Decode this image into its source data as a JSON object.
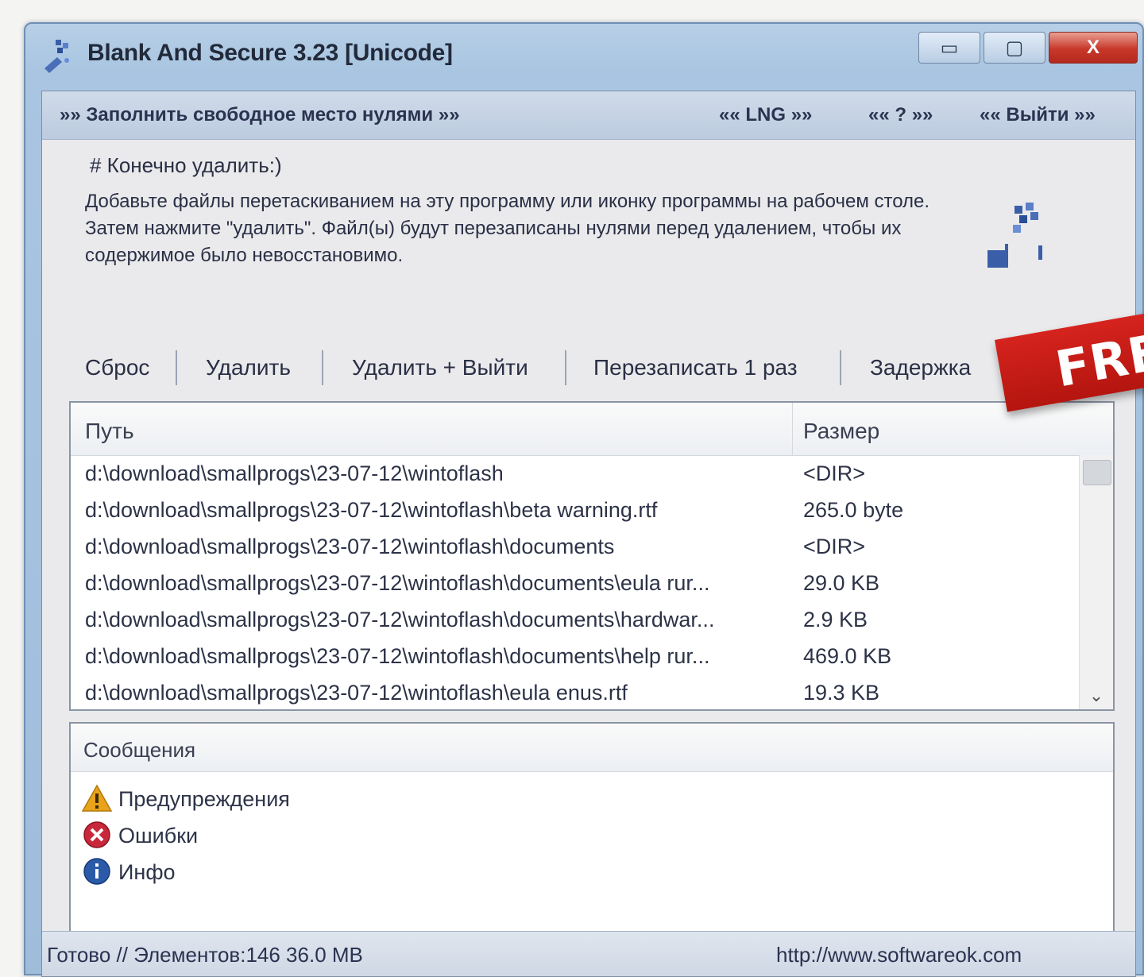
{
  "window": {
    "title": "Blank And Secure 3.23 [Unicode]",
    "controls": {
      "minimize": "▭",
      "maximize": "▢",
      "close": "X"
    }
  },
  "menu": {
    "fill_free_space": "»» Заполнить свободное место нулями »»",
    "language": "«« LNG »»",
    "help": "«« ? »»",
    "exit": "«« Выйти »»"
  },
  "options": {
    "confirm_delete": "# Конечно удалить:)"
  },
  "description": "Добавьте файлы перетаскиванием на эту программу или иконку программы на рабочем столе. Затем нажмите \"удалить\". Файл(ы) будут перезаписаны нулями перед удалением, чтобы их содержимое было невосстановимо.",
  "actions": {
    "reset": "Сброс",
    "delete": "Удалить",
    "delete_exit": "Удалить + Выйти",
    "overwrite": "Перезаписать 1 раз",
    "delay": "Задержка"
  },
  "file_list": {
    "columns": {
      "path": "Путь",
      "size": "Размер"
    },
    "rows": [
      {
        "path": "d:\\download\\smallprogs\\23-07-12\\wintoflash",
        "size": "<DIR>"
      },
      {
        "path": "d:\\download\\smallprogs\\23-07-12\\wintoflash\\beta warning.rtf",
        "size": "265.0 byte"
      },
      {
        "path": "d:\\download\\smallprogs\\23-07-12\\wintoflash\\documents",
        "size": "<DIR>"
      },
      {
        "path": "d:\\download\\smallprogs\\23-07-12\\wintoflash\\documents\\eula rur...",
        "size": "29.0 KB"
      },
      {
        "path": "d:\\download\\smallprogs\\23-07-12\\wintoflash\\documents\\hardwar...",
        "size": "2.9 KB"
      },
      {
        "path": "d:\\download\\smallprogs\\23-07-12\\wintoflash\\documents\\help rur...",
        "size": "469.0 KB"
      },
      {
        "path": "d:\\download\\smallprogs\\23-07-12\\wintoflash\\eula enus.rtf",
        "size": "19.3 KB"
      }
    ]
  },
  "messages": {
    "header": "Сообщения",
    "items": [
      {
        "label": "Предупреждения",
        "icon": "warning-icon",
        "color": "#e8a31a"
      },
      {
        "label": "Ошибки",
        "icon": "error-icon",
        "color": "#c8283a"
      },
      {
        "label": "Инфо",
        "icon": "info-icon",
        "color": "#2a5aa8"
      }
    ]
  },
  "status": {
    "left": "Готово // Элементов:146 36.0 MB",
    "right": "http://www.softwareok.com"
  },
  "badge": {
    "text": "FREE"
  }
}
